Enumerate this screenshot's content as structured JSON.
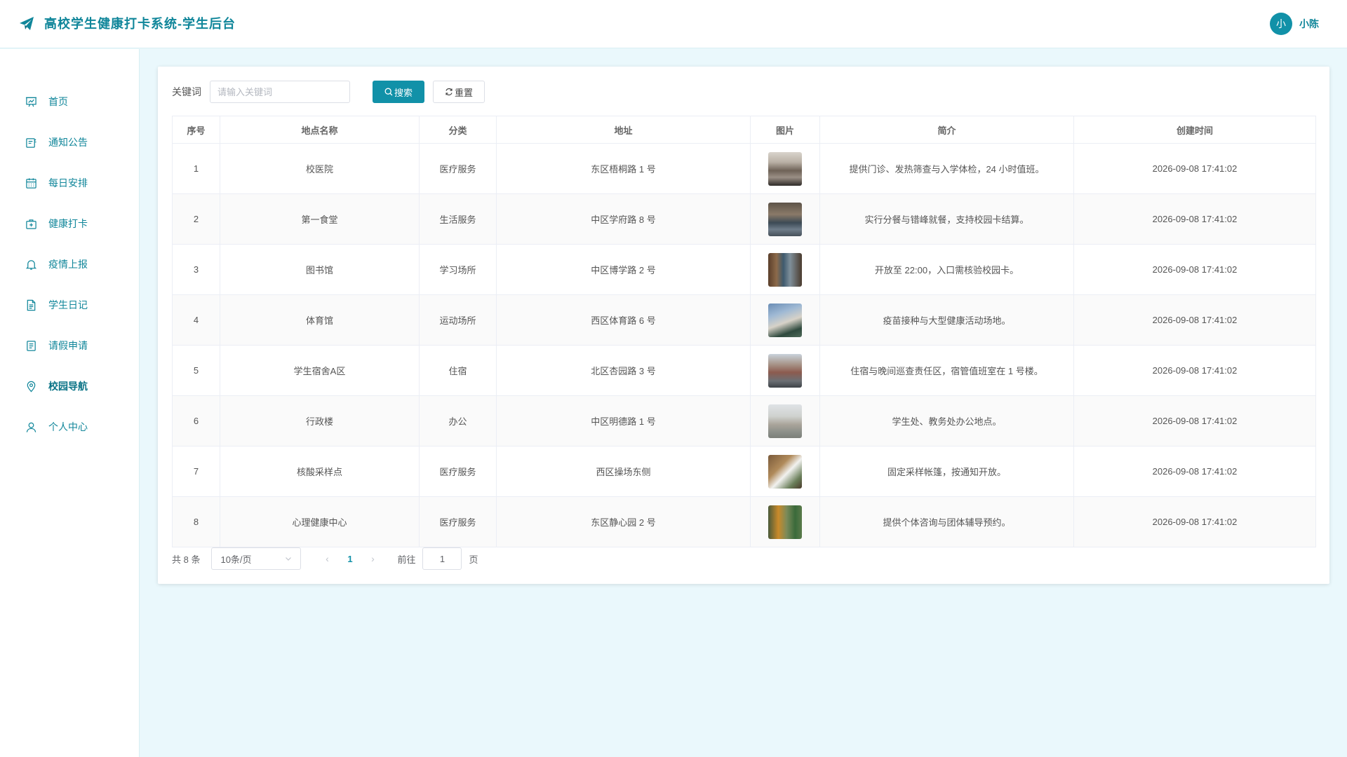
{
  "header": {
    "title": "高校学生健康打卡系统-学生后台",
    "logo_icon": "paper-plane-icon",
    "user": {
      "avatar_text": "小",
      "name": "小陈"
    }
  },
  "sidebar": {
    "items": [
      {
        "label": "首页",
        "icon": "presentation-chart-icon"
      },
      {
        "label": "通知公告",
        "icon": "notice-icon"
      },
      {
        "label": "每日安排",
        "icon": "calendar-icon"
      },
      {
        "label": "健康打卡",
        "icon": "medical-kit-icon"
      },
      {
        "label": "疫情上报",
        "icon": "bell-icon"
      },
      {
        "label": "学生日记",
        "icon": "document-icon"
      },
      {
        "label": "请假申请",
        "icon": "form-icon"
      },
      {
        "label": "校园导航",
        "icon": "location-pin-icon",
        "active": true
      },
      {
        "label": "个人中心",
        "icon": "user-icon"
      }
    ]
  },
  "search": {
    "label": "关键词",
    "placeholder": "请输入关键词",
    "value": "",
    "search_button": "搜索",
    "reset_button": "重置"
  },
  "table": {
    "columns": [
      "序号",
      "地点名称",
      "分类",
      "地址",
      "图片",
      "简介",
      "创建时间"
    ],
    "rows": [
      {
        "no": "1",
        "name": "校医院",
        "category": "医疗服务",
        "address": "东区梧桐路 1 号",
        "intro": "提供门诊、发热筛查与入学体检，24 小时值班。",
        "created": "2026-09-08 17:41:02"
      },
      {
        "no": "2",
        "name": "第一食堂",
        "category": "生活服务",
        "address": "中区学府路 8 号",
        "intro": "实行分餐与错峰就餐，支持校园卡结算。",
        "created": "2026-09-08 17:41:02"
      },
      {
        "no": "3",
        "name": "图书馆",
        "category": "学习场所",
        "address": "中区博学路 2 号",
        "intro": "开放至 22:00，入口需核验校园卡。",
        "created": "2026-09-08 17:41:02"
      },
      {
        "no": "4",
        "name": "体育馆",
        "category": "运动场所",
        "address": "西区体育路 6 号",
        "intro": "疫苗接种与大型健康活动场地。",
        "created": "2026-09-08 17:41:02"
      },
      {
        "no": "5",
        "name": "学生宿舍A区",
        "category": "住宿",
        "address": "北区杏园路 3 号",
        "intro": "住宿与晚间巡查责任区，宿管值班室在 1 号楼。",
        "created": "2026-09-08 17:41:02"
      },
      {
        "no": "6",
        "name": "行政楼",
        "category": "办公",
        "address": "中区明德路 1 号",
        "intro": "学生处、教务处办公地点。",
        "created": "2026-09-08 17:41:02"
      },
      {
        "no": "7",
        "name": "核酸采样点",
        "category": "医疗服务",
        "address": "西区操场东侧",
        "intro": "固定采样帐篷，按通知开放。",
        "created": "2026-09-08 17:41:02"
      },
      {
        "no": "8",
        "name": "心理健康中心",
        "category": "医疗服务",
        "address": "东区静心园 2 号",
        "intro": "提供个体咨询与团体辅导预约。",
        "created": "2026-09-08 17:41:02"
      }
    ]
  },
  "pagination": {
    "total_text": "共 8 条",
    "page_size": "10条/页",
    "current_page": "1",
    "goto_label": "前往",
    "goto_value": "1",
    "goto_suffix": "页"
  },
  "colors": {
    "accent": "#1191a8",
    "background": "#eaf8fc"
  }
}
